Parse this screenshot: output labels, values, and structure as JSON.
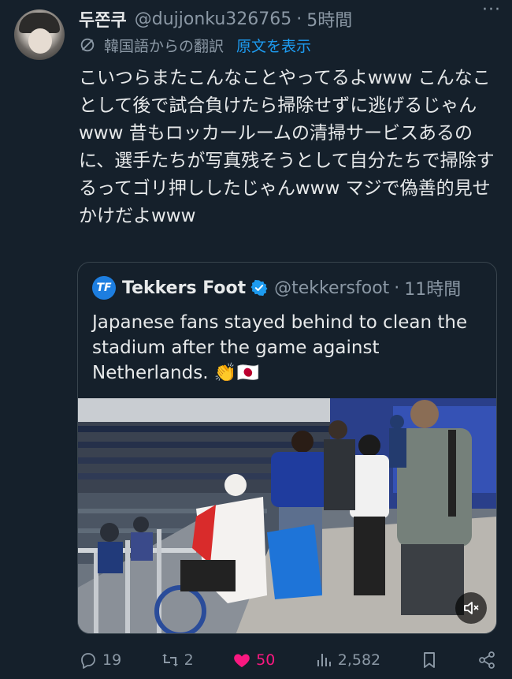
{
  "post": {
    "author_name": "두쫀쿠",
    "author_handle": "@dujjonku326765",
    "separator": "·",
    "time": "5時間",
    "more": "···",
    "translation_label": "韓国語からの翻訳",
    "show_original": "原文を表示",
    "text": "こいつらまたこんなことやってるよwww こんなことして後で試合負けたら掃除せずに逃げるじゃんwww 昔もロッカールームの清掃サービスあるのに、選手たちが写真残そうとして自分たちで掃除するってゴリ押ししたじゃんwww マジで偽善的見せかけだよwww"
  },
  "quote": {
    "avatar_text": "TF",
    "author_name": "Tekkers Foot",
    "author_handle": "@tekkersfoot",
    "separator": "·",
    "time": "11時間",
    "text": "Japanese fans stayed behind to clean the stadium after the game against Netherlands. 👏🇯🇵"
  },
  "actions": {
    "replies": "19",
    "reposts": "2",
    "likes": "50",
    "views": "2,582"
  },
  "colors": {
    "background": "#15202b",
    "accent": "#1d9bf0",
    "like": "#f91880",
    "muted": "#8b98a5"
  },
  "icons": [
    "no-translate-icon",
    "verified-icon",
    "mute-icon",
    "reply-icon",
    "repost-icon",
    "heart-icon",
    "views-icon",
    "bookmark-icon",
    "share-icon"
  ]
}
